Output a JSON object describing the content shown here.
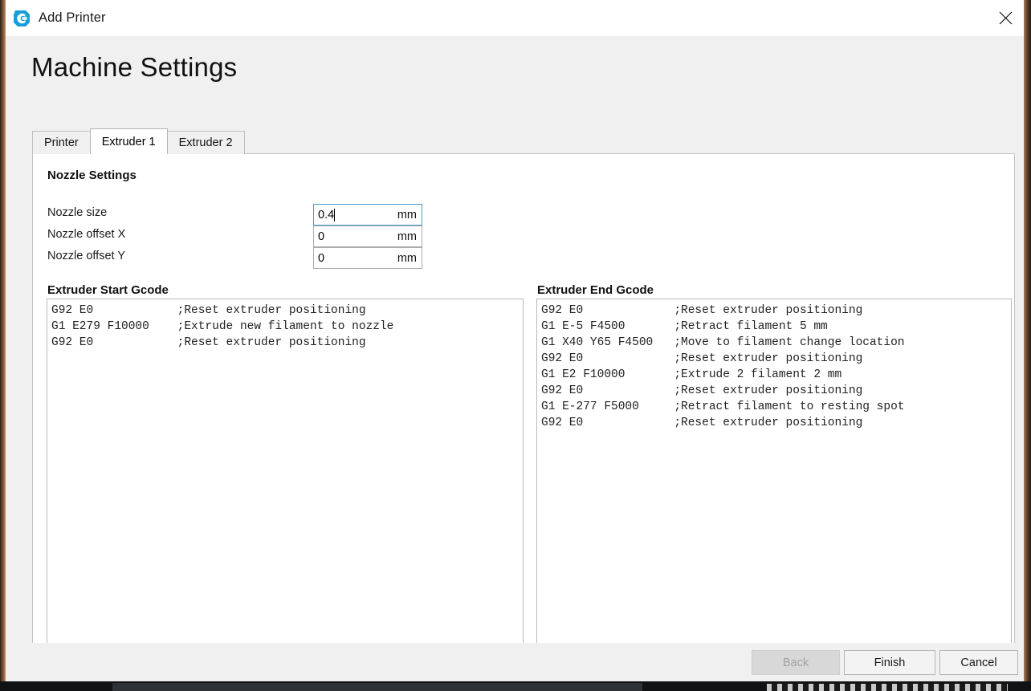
{
  "window": {
    "title": "Add Printer",
    "app_icon": "cura-logo-icon",
    "close_icon": "close-icon",
    "brand_color": "#1a9ed9"
  },
  "page": {
    "heading": "Machine Settings"
  },
  "tabs": [
    {
      "label": "Printer",
      "active": false
    },
    {
      "label": "Extruder 1",
      "active": true
    },
    {
      "label": "Extruder 2",
      "active": false
    }
  ],
  "nozzle_settings": {
    "heading": "Nozzle Settings",
    "fields": [
      {
        "label": "Nozzle size",
        "value": "0.4",
        "unit": "mm",
        "focused": true
      },
      {
        "label": "Nozzle offset X",
        "value": "0",
        "unit": "mm",
        "focused": false
      },
      {
        "label": "Nozzle offset Y",
        "value": "0",
        "unit": "mm",
        "focused": false
      }
    ]
  },
  "start_gcode": {
    "label": "Extruder Start Gcode",
    "lines": [
      "G92 E0            ;Reset extruder positioning",
      "G1 E279 F10000    ;Extrude new filament to nozzle",
      "G92 E0            ;Reset extruder positioning"
    ]
  },
  "end_gcode": {
    "label": "Extruder End Gcode",
    "lines": [
      "G92 E0             ;Reset extruder positioning",
      "G1 E-5 F4500       ;Retract filament 5 mm",
      "G1 X40 Y65 F4500   ;Move to filament change location",
      "G92 E0             ;Reset extruder positioning",
      "G1 E2 F10000       ;Extrude 2 filament 2 mm",
      "G92 E0             ;Reset extruder positioning",
      "G1 E-277 F5000     ;Retract filament to resting spot",
      "G92 E0             ;Reset extruder positioning"
    ]
  },
  "footer": {
    "back_label": "Back",
    "finish_label": "Finish",
    "cancel_label": "Cancel",
    "back_disabled": true
  }
}
